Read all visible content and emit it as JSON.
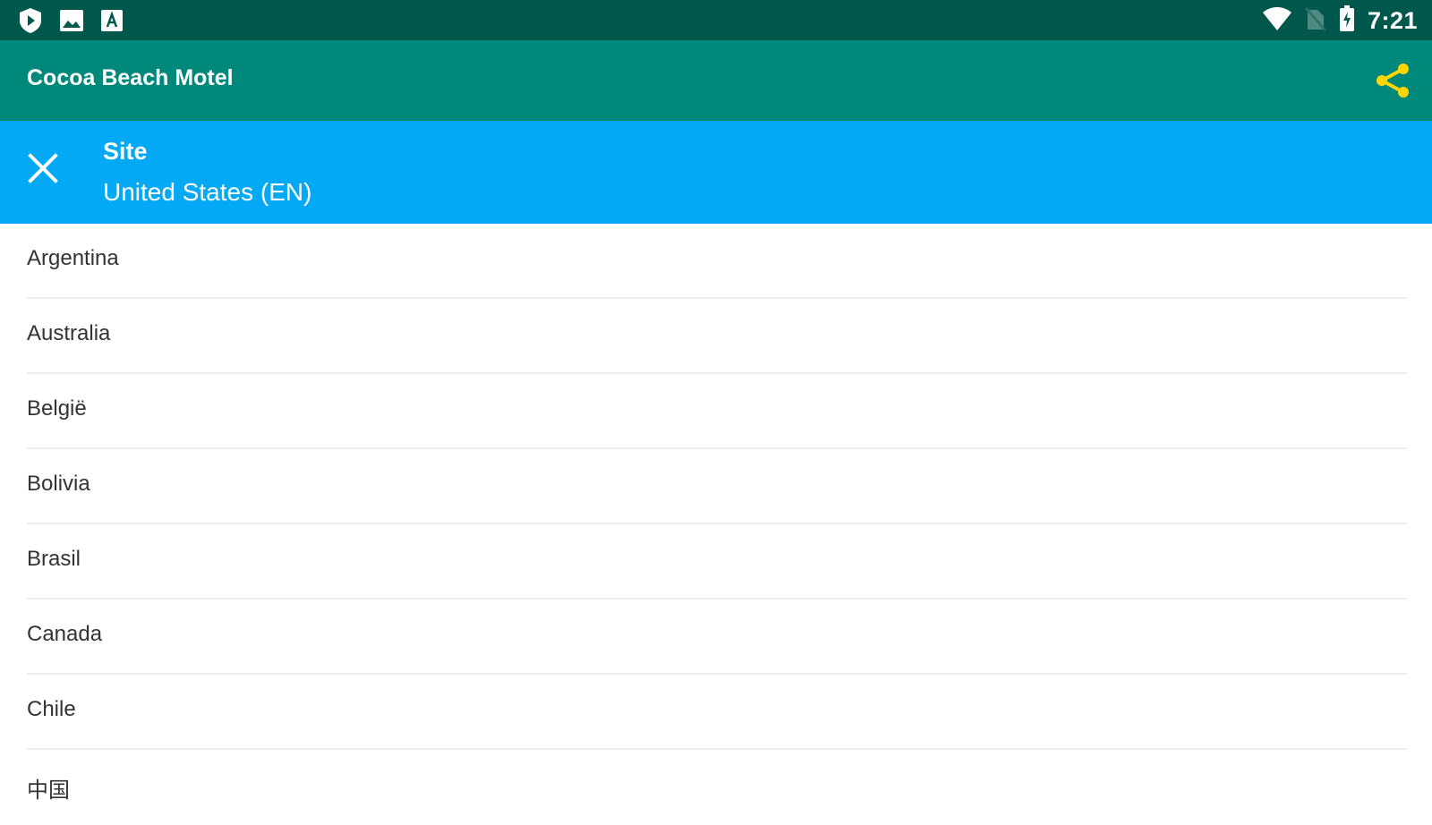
{
  "status_bar": {
    "time": "7:21",
    "left_icons": [
      "shield-play-icon",
      "image-icon",
      "font-icon"
    ],
    "right_icons": [
      "wifi-icon",
      "no-sim-icon",
      "battery-icon"
    ]
  },
  "app_bar": {
    "title": "Cocoa Beach Motel",
    "share_icon": "share-icon",
    "share_color": "#ffd600"
  },
  "site_header": {
    "label": "Site",
    "value": "United States (EN)",
    "close_icon": "close-icon"
  },
  "countries": [
    {
      "label": "Argentina"
    },
    {
      "label": "Australia"
    },
    {
      "label": "België"
    },
    {
      "label": "Bolivia"
    },
    {
      "label": "Brasil"
    },
    {
      "label": "Canada"
    },
    {
      "label": "Chile"
    },
    {
      "label": "中国"
    }
  ],
  "colors": {
    "status_bar": "#00574b",
    "app_bar": "#00897b",
    "site_bar": "#03a9f4"
  }
}
